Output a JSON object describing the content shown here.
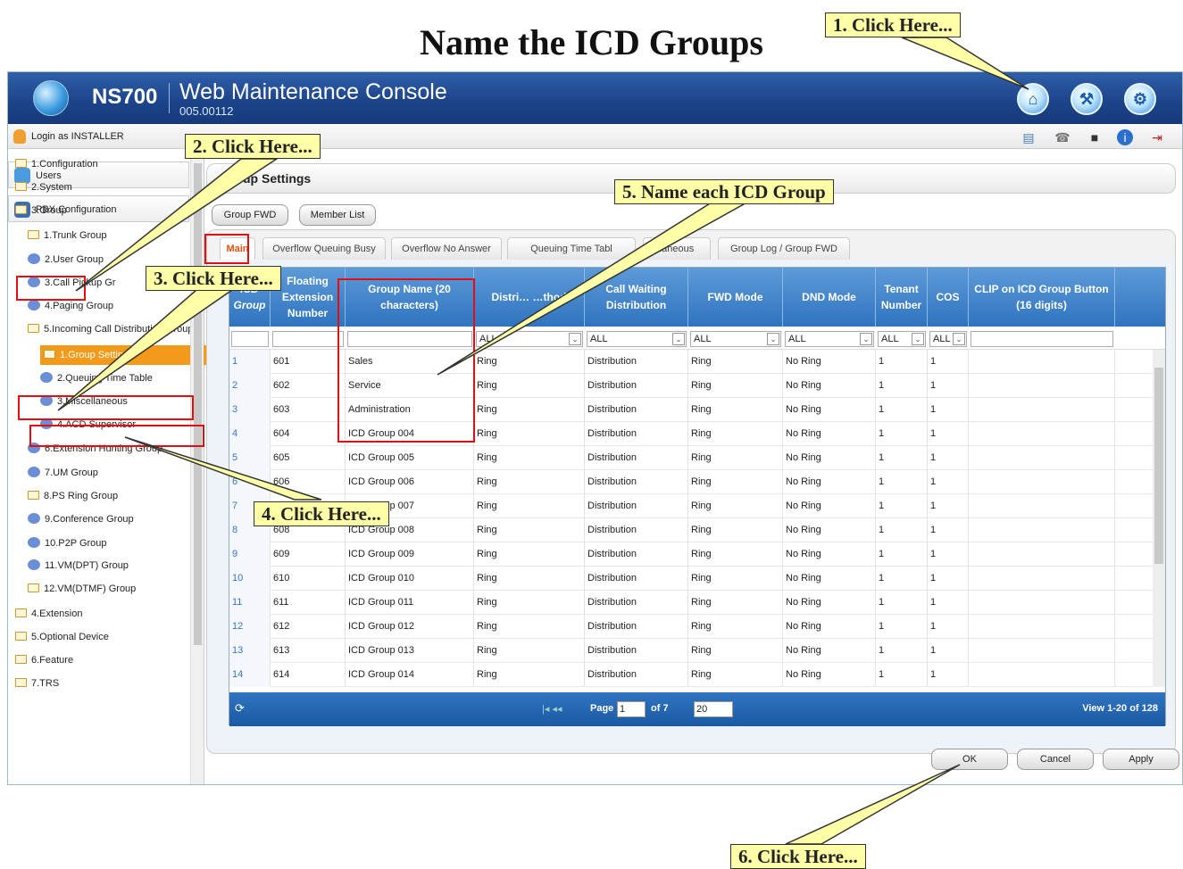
{
  "page_title": "Name the ICD Groups",
  "callouts": [
    "1. Click Here...",
    "2. Click Here...",
    "3. Click Here...",
    "4. Click Here...",
    "5. Name each ICD Group",
    "6. Click Here..."
  ],
  "app": {
    "product": "NS700",
    "console_title": "Web Maintenance Console",
    "version": "005.00112",
    "login": "Login as INSTALLER"
  },
  "sidebar": {
    "users": "Users",
    "pbx": "PBX Configuration",
    "tree": [
      "1.Configuration",
      "2.System",
      "3.Group",
      "1.Trunk Group",
      "2.User Group",
      "3.Call Pickup Gr",
      "4.Paging Group",
      "5.Incoming Call Distribution Group",
      "1.Group Settings",
      "2.Queuing Time Table",
      "3.Miscellaneous",
      "4.ACD Supervisor",
      "6.Extension Hunting Group",
      "7.UM Group",
      "8.PS Ring Group",
      "9.Conference Group",
      "10.P2P Group",
      "11.VM(DPT) Group",
      "12.VM(DTMF) Group",
      "4.Extension",
      "5.Optional Device",
      "6.Feature",
      "7.TRS"
    ]
  },
  "panel": {
    "title": "roup Settings",
    "group_fwd_button": "Group FWD",
    "member_list_button": "Member List",
    "tabs": [
      "Main",
      "Overflow Queuing Busy",
      "Overflow No Answer",
      "Queuing Time Tabl",
      "laneous",
      "Group Log / Group FWD"
    ]
  },
  "grid": {
    "headers": [
      "ICD Group",
      "Floating Extension Number",
      "Group Name (20 characters)",
      "Distri… …thod",
      "Call Waiting Distribution",
      "FWD Mode",
      "DND Mode",
      "Tenant Number",
      "COS",
      "CLIP on ICD Group Button (16 digits)"
    ],
    "filter_all": "ALL",
    "rows": [
      [
        "1",
        "601",
        "Sales",
        "Ring",
        "Distribution",
        "Ring",
        "No Ring",
        "1",
        "1"
      ],
      [
        "2",
        "602",
        "Service",
        "Ring",
        "Distribution",
        "Ring",
        "No Ring",
        "1",
        "1"
      ],
      [
        "3",
        "603",
        "Administration",
        "Ring",
        "Distribution",
        "Ring",
        "No Ring",
        "1",
        "1"
      ],
      [
        "4",
        "604",
        "ICD Group 004",
        "Ring",
        "Distribution",
        "Ring",
        "No Ring",
        "1",
        "1"
      ],
      [
        "5",
        "605",
        "ICD Group 005",
        "Ring",
        "Distribution",
        "Ring",
        "No Ring",
        "1",
        "1"
      ],
      [
        "6",
        "606",
        "ICD Group 006",
        "Ring",
        "Distribution",
        "Ring",
        "No Ring",
        "1",
        "1"
      ],
      [
        "7",
        "607",
        "ICD Group 007",
        "Ring",
        "Distribution",
        "Ring",
        "No Ring",
        "1",
        "1"
      ],
      [
        "8",
        "608",
        "ICD Group 008",
        "Ring",
        "Distribution",
        "Ring",
        "No Ring",
        "1",
        "1"
      ],
      [
        "9",
        "609",
        "ICD Group 009",
        "Ring",
        "Distribution",
        "Ring",
        "No Ring",
        "1",
        "1"
      ],
      [
        "10",
        "610",
        "ICD Group 010",
        "Ring",
        "Distribution",
        "Ring",
        "No Ring",
        "1",
        "1"
      ],
      [
        "11",
        "611",
        "ICD Group 011",
        "Ring",
        "Distribution",
        "Ring",
        "No Ring",
        "1",
        "1"
      ],
      [
        "12",
        "612",
        "ICD Group 012",
        "Ring",
        "Distribution",
        "Ring",
        "No Ring",
        "1",
        "1"
      ],
      [
        "13",
        "613",
        "ICD Group 013",
        "Ring",
        "Distribution",
        "Ring",
        "No Ring",
        "1",
        "1"
      ],
      [
        "14",
        "614",
        "ICD Group 014",
        "Ring",
        "Distribution",
        "Ring",
        "No Ring",
        "1",
        "1"
      ]
    ],
    "pager": {
      "page_label": "Page",
      "page_value": "1",
      "of_label": "of 7",
      "page_size": "20",
      "view": "View 1-20 of 128"
    }
  },
  "footer": {
    "ok": "OK",
    "cancel": "Cancel",
    "apply": "Apply"
  }
}
